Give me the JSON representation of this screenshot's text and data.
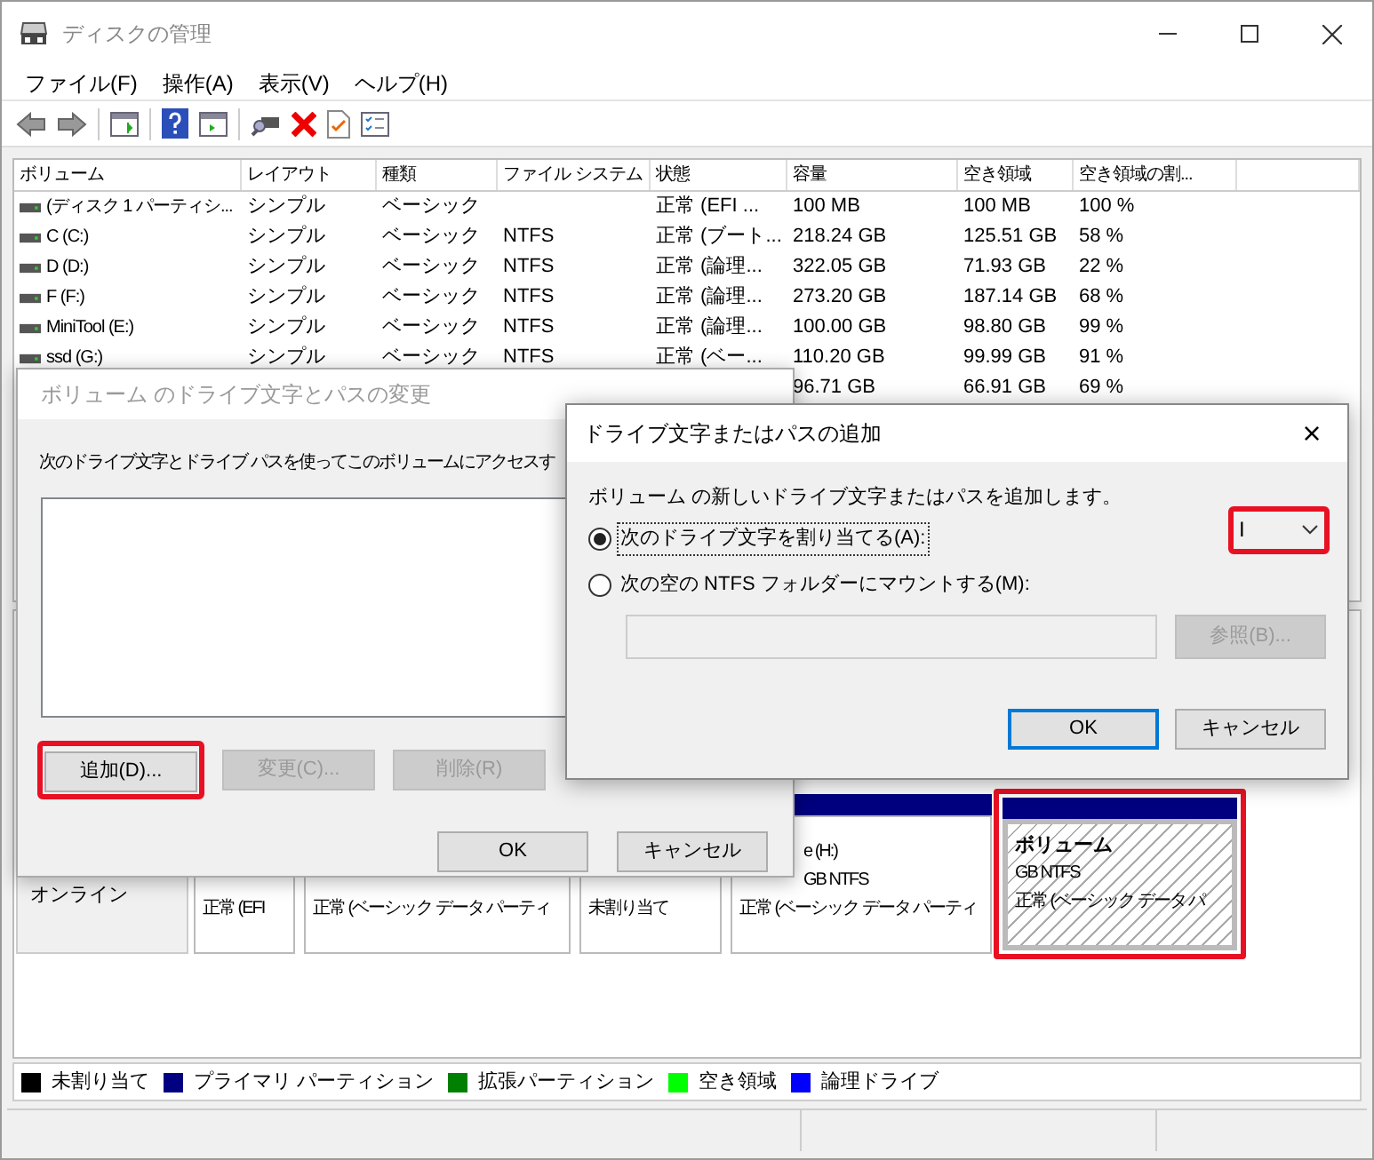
{
  "window": {
    "title": "ディスクの管理"
  },
  "menu": [
    "ファイル(F)",
    "操作(A)",
    "表示(V)",
    "ヘルプ(H)"
  ],
  "table": {
    "columns": [
      "ボリューム",
      "レイアウト",
      "種類",
      "ファイル システム",
      "状態",
      "容量",
      "空き領域",
      "空き領域の割..."
    ],
    "rows": [
      {
        "volume": "(ディスク 1 パーティシ...",
        "layout": "シンプル",
        "type": "ベーシック",
        "status": "正常 (EFI ...",
        "capacity": "100 MB",
        "free": "100 MB",
        "free_pct": "100 %"
      },
      {
        "volume": "C (C:)",
        "layout": "シンプル",
        "type": "ベーシック",
        "fs": "NTFS",
        "status": "正常 (ブート...",
        "capacity": "218.24 GB",
        "free": "125.51 GB",
        "free_pct": "58 %"
      },
      {
        "volume": "D (D:)",
        "layout": "シンプル",
        "type": "ベーシック",
        "fs": "NTFS",
        "status": "正常 (論理...",
        "capacity": "322.05 GB",
        "free": "71.93 GB",
        "free_pct": "22 %"
      },
      {
        "volume": "F (F:)",
        "layout": "シンプル",
        "type": "ベーシック",
        "fs": "NTFS",
        "status": "正常 (論理...",
        "capacity": "273.20 GB",
        "free": "187.14 GB",
        "free_pct": "68 %"
      },
      {
        "volume": "MiniTool (E:)",
        "layout": "シンプル",
        "type": "ベーシック",
        "fs": "NTFS",
        "status": "正常 (論理...",
        "capacity": "100.00 GB",
        "free": "98.80 GB",
        "free_pct": "99 %"
      },
      {
        "volume": "ssd (G:)",
        "layout": "シンプル",
        "type": "ベーシック",
        "fs": "NTFS",
        "status": "正常 (ベー...",
        "capacity": "110.20 GB",
        "free": "99.99 GB",
        "free_pct": "91 %"
      },
      {
        "capacity": "96.71 GB",
        "free": "66.91 GB",
        "free_pct": "69 %"
      }
    ]
  },
  "disk": {
    "status": "オンライン",
    "partitions": [
      {
        "selected": false,
        "hatched": false,
        "lines": [
          "正常 (EFI"
        ]
      },
      {
        "selected": false,
        "hatched": false,
        "lines": [
          "正常 (ベーシック データ パーティ"
        ]
      },
      {
        "selected": false,
        "hatched": false,
        "lines": [
          "未割り当て"
        ]
      },
      {
        "kind": "primary",
        "selected": false,
        "hatched": false,
        "lines": [
          "e (H:)",
          "GB NTFS",
          "正常 (ベーシック データ パーティ"
        ]
      },
      {
        "kind": "primary",
        "selected": true,
        "hatched": true,
        "name": "ボリューム",
        "lines": [
          "GB NTFS",
          "正常 (ベーシック データ パ"
        ]
      }
    ]
  },
  "legend": [
    {
      "label": "未割り当て",
      "color": "#000000"
    },
    {
      "label": "プライマリ パーティション",
      "color": "#000080"
    },
    {
      "label": "拡張パーティション",
      "color": "#008000"
    },
    {
      "label": "空き領域",
      "color": "#00ff00"
    },
    {
      "label": "論理ドライブ",
      "color": "#0000ff"
    }
  ],
  "dialog_change": {
    "title": "ボリューム のドライブ文字とパスの変更",
    "active": false,
    "text": "次のドライブ文字とドライブ パスを使ってこのボリュームにアクセスす",
    "buttons": [
      {
        "label": "追加(D)...",
        "disabled": false,
        "highlighted": true
      },
      {
        "label": "変更(C)...",
        "disabled": true,
        "highlighted": false
      },
      {
        "label": "削除(R)",
        "disabled": true,
        "highlighted": false
      }
    ],
    "footer_buttons": [
      {
        "label": "OK",
        "default": false
      },
      {
        "label": "キャンセル",
        "default": false
      }
    ]
  },
  "dialog_add": {
    "title": "ドライブ文字またはパスの追加",
    "active": true,
    "close": "×",
    "text": "ボリューム の新しいドライブ文字またはパスを追加します。",
    "options": [
      {
        "label": "次のドライブ文字を割り当てる(A):",
        "selected": true,
        "focused": true
      },
      {
        "label": "次の空の NTFS フォルダーにマウントする(M):",
        "selected": false,
        "focused": false
      }
    ],
    "letter": {
      "value": "I",
      "highlighted": true
    },
    "folder_field": {
      "disabled": true
    },
    "browse": {
      "label": "参照(B)...",
      "disabled": true
    },
    "footer_buttons": [
      {
        "label": "OK",
        "default": true
      },
      {
        "label": "キャンセル",
        "default": false
      }
    ]
  }
}
